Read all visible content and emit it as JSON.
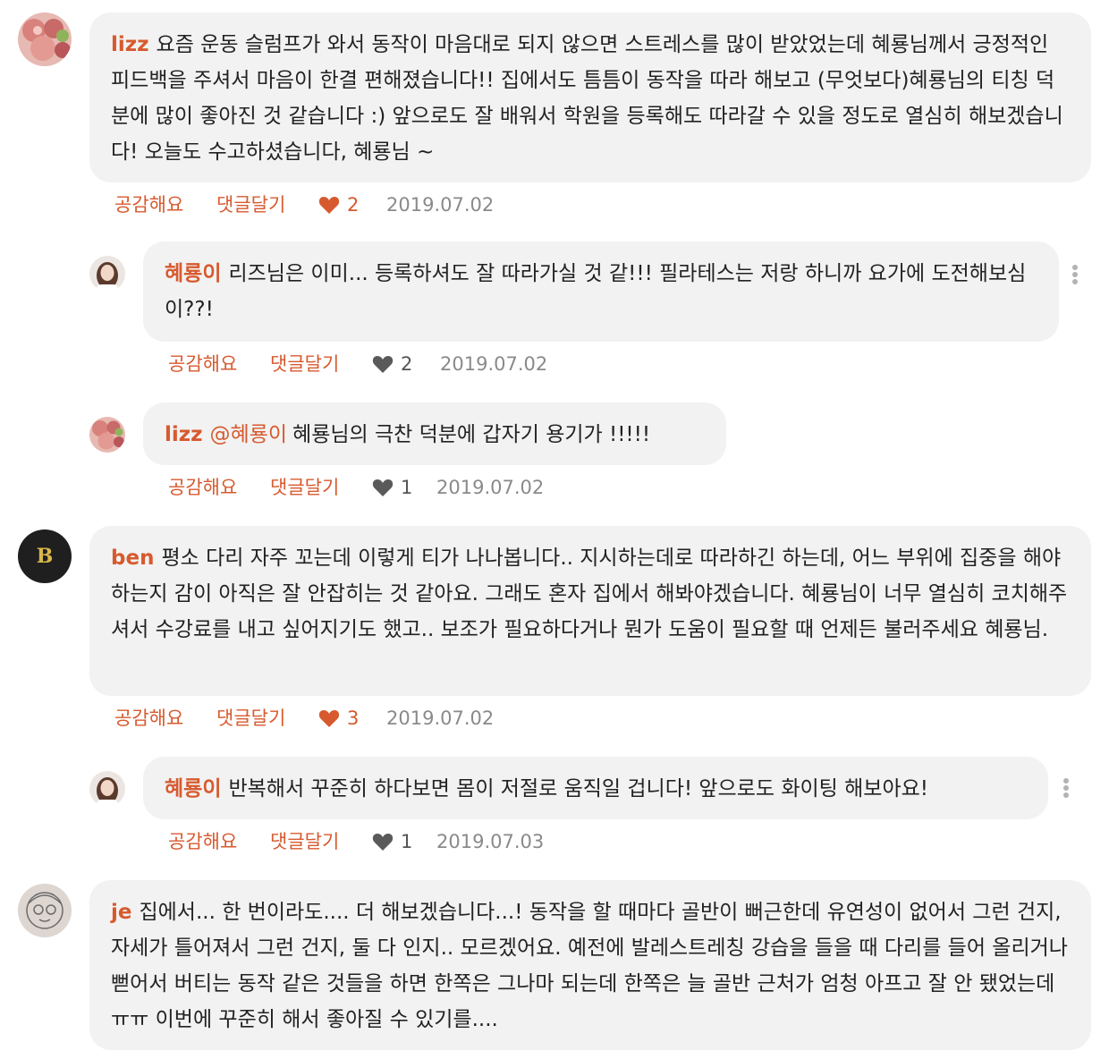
{
  "labels": {
    "like_action": "공감해요",
    "reply_action": "댓글달기"
  },
  "colors": {
    "accent": "#d75a2f",
    "bubble": "#f2f2f2",
    "date": "#8a8a8a",
    "heart_inactive": "#5a5a5a"
  },
  "comments": [
    {
      "author": "lizz",
      "text": "요즘 운동 슬럼프가 와서 동작이 마음대로 되지 않으면 스트레스를 많이 받았었는데 혜룡님께서 긍정적인 피드백을 주셔서 마음이 한결 편해졌습니다!! 집에서도 틈틈이 동작을 따라 해보고 (무엇보다)혜룡님의 티칭 덕분에 많이 좋아진 것 같습니다 :) 앞으로도 잘 배워서 학원을 등록해도 따라갈 수 있을 정도로 열심히 해보겠습니다! 오늘도 수고하셨습니다, 혜룡님 ~",
      "likes": "2",
      "date": "2019.07.02",
      "avatar": "flowers-avatar"
    },
    {
      "author": "혜룡이",
      "text": "리즈님은 이미... 등록하셔도 잘 따라가실 것 같!!! 필라테스는 저랑 하니까 요가에 도전해보심이??!",
      "likes": "2",
      "date": "2019.07.02",
      "avatar": "profile-photo-avatar"
    },
    {
      "author": "lizz",
      "mention": "@혜룡이",
      "text": "혜룡님의 극찬 덕분에 갑자기 용기가 !!!!!",
      "likes": "1",
      "date": "2019.07.02",
      "avatar": "flowers-avatar"
    },
    {
      "author": "ben",
      "text": "평소 다리 자주 꼬는데 이렇게 티가 나나봅니다.. 지시하는데로 따라하긴 하는데, 어느 부위에 집중을 해야하는지 감이 아직은 잘 안잡히는 것 같아요. 그래도 혼자 집에서 해봐야겠습니다. 혜룡님이 너무 열심히 코치해주셔서 수강료를 내고 싶어지기도 했고.. 보조가 필요하다거나 뭔가 도움이 필요할 때 언제든 불러주세요 혜룡님.",
      "likes": "3",
      "date": "2019.07.02",
      "avatar_letter": "B"
    },
    {
      "author": "혜룡이",
      "text": "반복해서 꾸준히 하다보면 몸이 저절로 움직일 겁니다! 앞으로도 화이팅 해보아요!",
      "likes": "1",
      "date": "2019.07.03",
      "avatar": "profile-photo-avatar"
    },
    {
      "author": "je",
      "text": "집에서... 한 번이라도.... 더 해보겠습니다...! 동작을 할 때마다 골반이 뻐근한데 유연성이 없어서 그런 건지, 자세가 틀어져서 그런 건지, 둘 다 인지.. 모르겠어요. 예전에 발레스트레칭 강습을 들을 때 다리를 들어 올리거나 뻗어서 버티는 동작 같은 것들을 하면 한쪽은 그나마 되는데 한쪽은 늘 골반 근처가 엄청 아프고 잘 안 됐었는데 ㅠㅠ 이번에 꾸준히 해서 좋아질 수 있기를....",
      "avatar": "sketch-avatar"
    }
  ]
}
